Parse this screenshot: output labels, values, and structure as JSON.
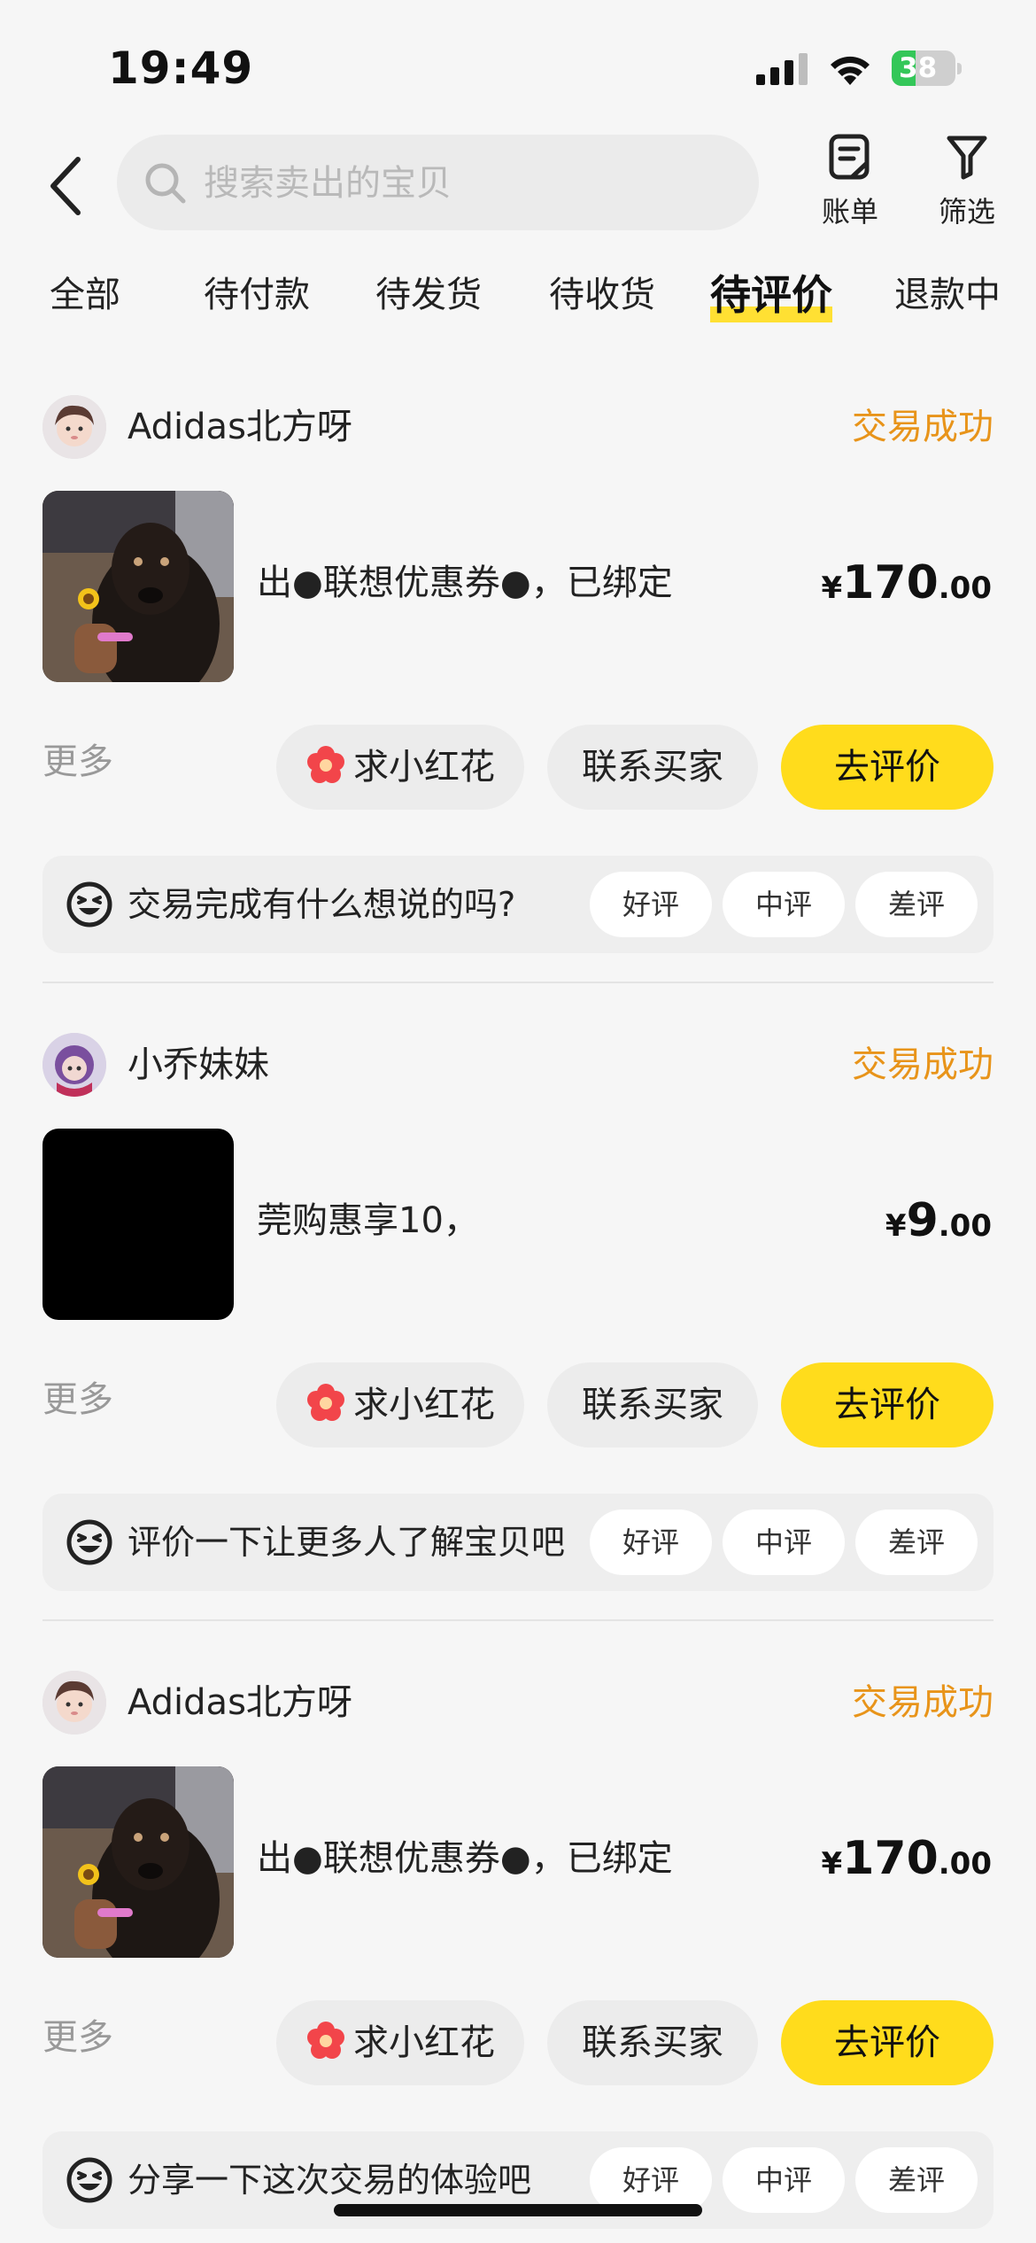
{
  "status_bar": {
    "time": "19:49",
    "battery_level": "38",
    "battery_fraction": 0.38
  },
  "header": {
    "search_placeholder": "搜索卖出的宝贝",
    "bill_label": "账单",
    "filter_label": "筛选"
  },
  "tabs": [
    {
      "label": "全部",
      "active": false
    },
    {
      "label": "待付款",
      "active": false
    },
    {
      "label": "待发货",
      "active": false
    },
    {
      "label": "待收货",
      "active": false
    },
    {
      "label": "待评价",
      "active": true
    },
    {
      "label": "退款中",
      "active": false
    }
  ],
  "orders": [
    {
      "seller": "Adidas北方呀",
      "status": "交易成功",
      "title": "出●联想优惠券●，已绑定",
      "price_symbol": "¥",
      "price_int": "170",
      "price_dec": ".00",
      "more": "更多",
      "flower_btn": "求小红花",
      "contact_btn": "联系买家",
      "review_btn": "去评价",
      "prompt": "交易完成有什么想说的吗?",
      "rate_good": "好评",
      "rate_mid": "中评",
      "rate_bad": "差评"
    },
    {
      "seller": "小乔妹妹",
      "status": "交易成功",
      "title": "莞购惠享10，",
      "price_symbol": "¥",
      "price_int": "9",
      "price_dec": ".00",
      "more": "更多",
      "flower_btn": "求小红花",
      "contact_btn": "联系买家",
      "review_btn": "去评价",
      "prompt": "评价一下让更多人了解宝贝吧",
      "rate_good": "好评",
      "rate_mid": "中评",
      "rate_bad": "差评"
    },
    {
      "seller": "Adidas北方呀",
      "status": "交易成功",
      "title": "出●联想优惠券●，已绑定",
      "price_symbol": "¥",
      "price_int": "170",
      "price_dec": ".00",
      "more": "更多",
      "flower_btn": "求小红花",
      "contact_btn": "联系买家",
      "review_btn": "去评价",
      "prompt": "分享一下这次交易的体验吧",
      "rate_good": "好评",
      "rate_mid": "中评",
      "rate_bad": "差评"
    }
  ],
  "colors": {
    "accent_yellow": "#ffdc1c",
    "status_orange": "#e8941a",
    "battery_green": "#34c759"
  },
  "icons": [
    "back-icon",
    "search-icon",
    "bill-icon",
    "filter-icon",
    "flower-icon",
    "grin-icon"
  ]
}
